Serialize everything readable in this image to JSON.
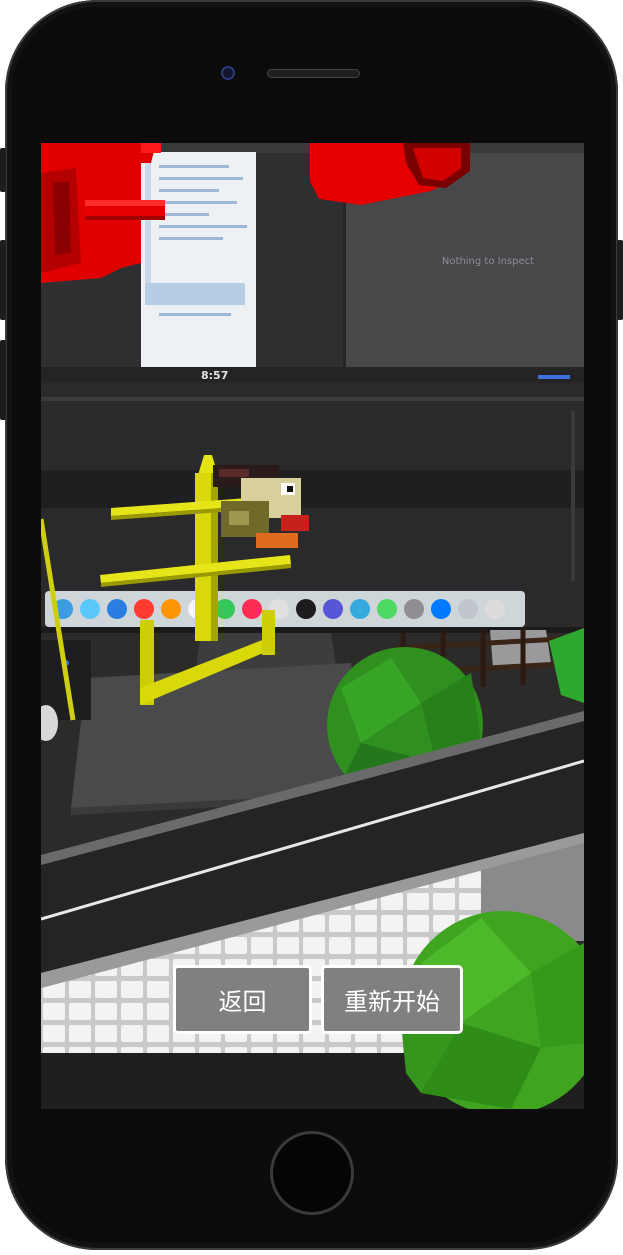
{
  "buttons": {
    "back_label": "返回",
    "restart_label": "重新开始"
  },
  "scene": {
    "monitor_text": "Nothing to Inspect",
    "monitor_time": "8:57"
  },
  "colors": {
    "button_bg": "#808080",
    "button_border": "#ffffff",
    "button_text": "#ffffff",
    "pipe_red": "#e10000",
    "pipe_yellow": "#d9d90a",
    "tree_green": "#3fa520",
    "road": "#242424"
  }
}
